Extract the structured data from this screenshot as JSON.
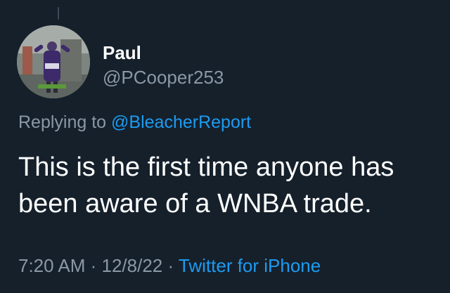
{
  "tweet": {
    "display_name": "Paul",
    "handle": "@PCooper253",
    "replying_prefix": "Replying to ",
    "replying_to": "@BleacherReport",
    "text_line1": "This is the first time anyone has",
    "text_line2": "been aware of a WNBA trade.",
    "time": "7:20 AM",
    "separator": " · ",
    "date": "12/8/22",
    "source": "Twitter for iPhone"
  },
  "colors": {
    "background": "#15202b",
    "primary_text": "#ffffff",
    "secondary_text": "#8b98a5",
    "accent": "#1d9bf0"
  }
}
